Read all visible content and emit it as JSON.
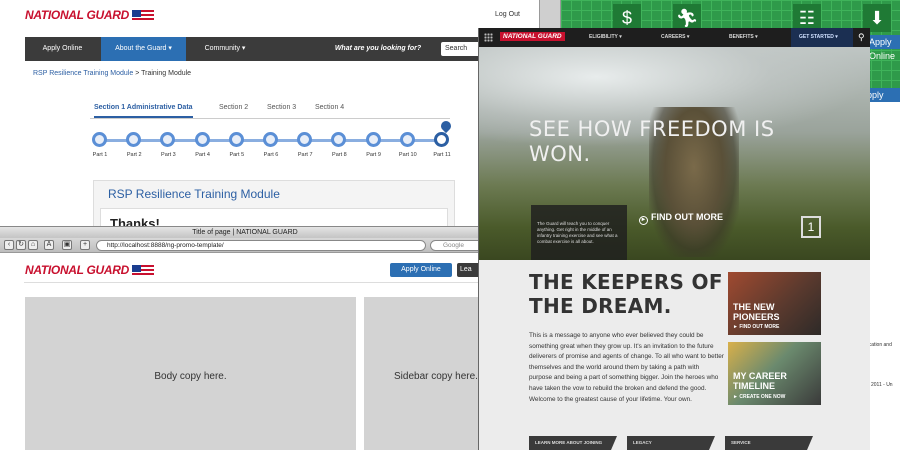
{
  "green_window": {
    "icons": [
      "dollar-icon",
      "runner-icon",
      "network-icon",
      "download-icon"
    ],
    "apply_label": "Apply Online",
    "side_labels": [
      "Apply Online",
      "Apply Online"
    ],
    "footer_snippets": [
      "ucation and",
      "D 2011 - Un"
    ]
  },
  "back_window": {
    "logo_text": "NATIONAL GUARD",
    "logout": "Log Out",
    "nav": {
      "apply": "Apply Online",
      "about": "About the Guard",
      "community": "Community",
      "search_question": "What are you looking for?",
      "search_value": "Search"
    },
    "breadcrumb": {
      "link": "RSP Resilience Training Module",
      "sep": ">",
      "current": "Training Module"
    },
    "sections": [
      "Section 1 Administrative Data",
      "Section 2",
      "Section 3",
      "Section 4"
    ],
    "parts": [
      "Part 1",
      "Part 2",
      "Part 3",
      "Part 4",
      "Part 5",
      "Part 6",
      "Part 7",
      "Part 8",
      "Part 9",
      "Part 10",
      "Part 11"
    ],
    "module_title": "RSP Resilience Training Module",
    "thanks": "Thanks!"
  },
  "front_window": {
    "title": "Title of page | NATIONAL GUARD",
    "url": "http://localhost:8888/ng-promo-template/",
    "search_placeholder": "Google",
    "logo_text": "NATIONAL GUARD",
    "apply_button": "Apply Online",
    "learn_button": "Lea",
    "body_copy": "Body copy here.",
    "sidebar_copy": "Sidebar copy here."
  },
  "right_window": {
    "logo": "NATIONAL GUARD",
    "nav_items": [
      "ELIGIBILITY",
      "CAREERS",
      "BENEFITS"
    ],
    "get_started": "GET STARTED",
    "hero": {
      "headline": "SEE HOW FREEDOM IS WON.",
      "caption": "The Guard will teach you to conquer anything. Get right in the middle of an infantry training exercise and see what a combat exercise is all about.",
      "cta": "FIND OUT MORE",
      "counter": "1"
    },
    "keepers_title": "THE KEEPERS OF THE DREAM.",
    "keepers_body": "This is a message to anyone who ever believed they could be something great when they grow up. It's an invitation to the future deliverers of promise and agents of change. To all who want to better themselves and the world around them by taking a path with purpose and being a part of something bigger. Join the heroes who have taken the vow to rebuild the broken and defend the good. Welcome to the greatest cause of your lifetime. Your own.",
    "promos": [
      {
        "title": "THE NEW PIONEERS",
        "cta": "FIND OUT MORE"
      },
      {
        "title": "MY CAREER TIMELINE",
        "cta": "CREATE ONE NOW"
      }
    ],
    "bottom_tabs": [
      "LEARN MORE ABOUT JOINING",
      "LEGACY",
      "SERVICE"
    ]
  },
  "colors": {
    "brand_red": "#c8102e",
    "accent_blue": "#2c6fb3",
    "nav_dark": "#3b3b3b"
  }
}
